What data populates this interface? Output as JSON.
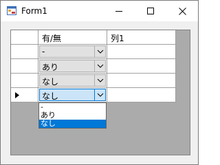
{
  "window": {
    "title": "Form1",
    "icons": {
      "app": "form-icon",
      "minimize": "minimize-icon",
      "maximize": "maximize-icon",
      "close": "close-icon"
    }
  },
  "grid": {
    "columns": [
      {
        "header": "有/無",
        "type": "combobox"
      },
      {
        "header": "列1",
        "type": "text"
      }
    ],
    "rows": [
      {
        "col0": "-",
        "col1": ""
      },
      {
        "col0": "あり",
        "col1": ""
      },
      {
        "col0": "なし",
        "col1": ""
      },
      {
        "col0": "なし",
        "col1": "",
        "current": true,
        "row_header_icon": "current-row-arrow-icon"
      }
    ],
    "dropdown": {
      "options": [
        "-",
        "あり",
        "なし"
      ],
      "selected": "なし"
    }
  },
  "colors": {
    "grid_background": "#ababab",
    "selection": "#0078d7",
    "combo_active": "#cce4f7"
  }
}
